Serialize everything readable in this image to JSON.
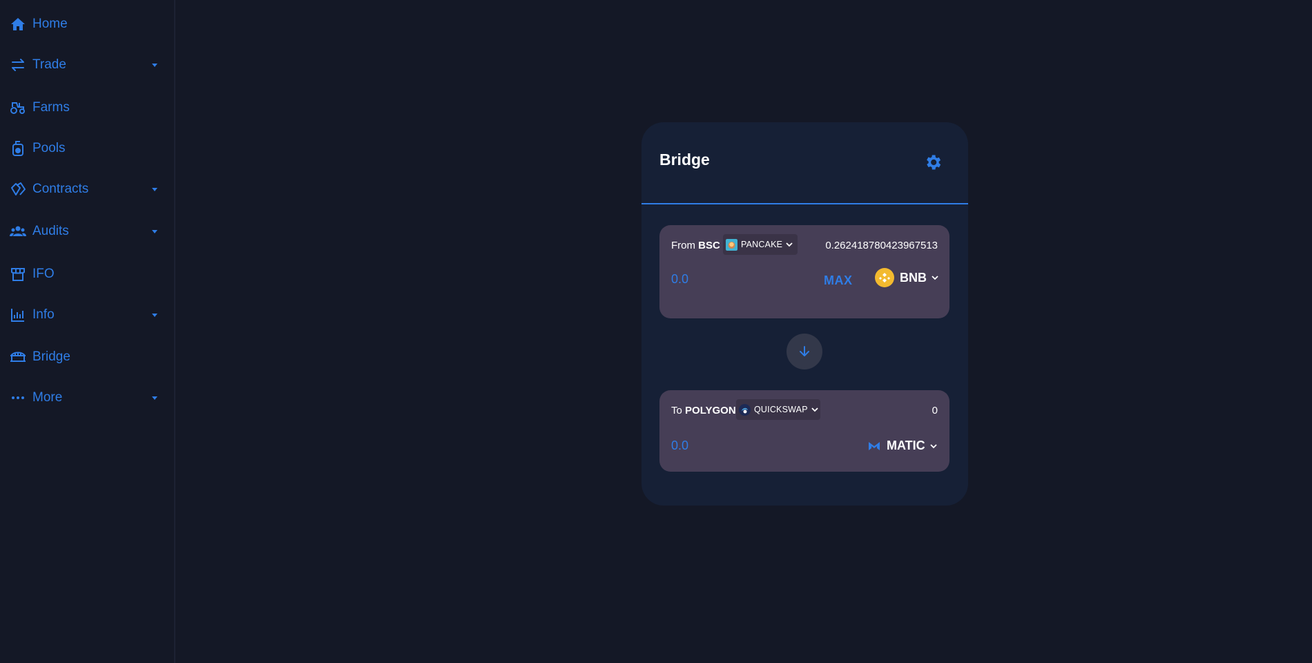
{
  "sidebar": {
    "items": [
      {
        "label": "Home",
        "icon": "home-icon",
        "has_dropdown": false
      },
      {
        "label": "Trade",
        "icon": "trade-icon",
        "has_dropdown": true
      },
      {
        "label": "Farms",
        "icon": "tractor-icon",
        "has_dropdown": false
      },
      {
        "label": "Pools",
        "icon": "pool-icon",
        "has_dropdown": false
      },
      {
        "label": "Contracts",
        "icon": "contracts-icon",
        "has_dropdown": true
      },
      {
        "label": "Audits",
        "icon": "users-icon",
        "has_dropdown": true
      },
      {
        "label": "IFO",
        "icon": "store-icon",
        "has_dropdown": false
      },
      {
        "label": "Info",
        "icon": "chart-icon",
        "has_dropdown": true
      },
      {
        "label": "Bridge",
        "icon": "bridge-icon",
        "has_dropdown": false
      },
      {
        "label": "More",
        "icon": "more-icon",
        "has_dropdown": true
      }
    ]
  },
  "bridge": {
    "title": "Bridge",
    "from": {
      "prefix": "From",
      "chain": "BSC",
      "dex": "PANCAKE",
      "balance": "0.262418780423967513",
      "amount_placeholder": "0.0",
      "max_label": "MAX",
      "token": "BNB"
    },
    "to": {
      "prefix": "To",
      "chain": "POLYGON",
      "dex": "QUICKSWAP",
      "balance": "0",
      "amount_placeholder": "0.0",
      "token": "MATIC"
    }
  },
  "colors": {
    "background": "#141826",
    "accent": "#2f7de6",
    "card": "#162036",
    "panel": "#463e56",
    "bnb": "#f3ba2f"
  }
}
